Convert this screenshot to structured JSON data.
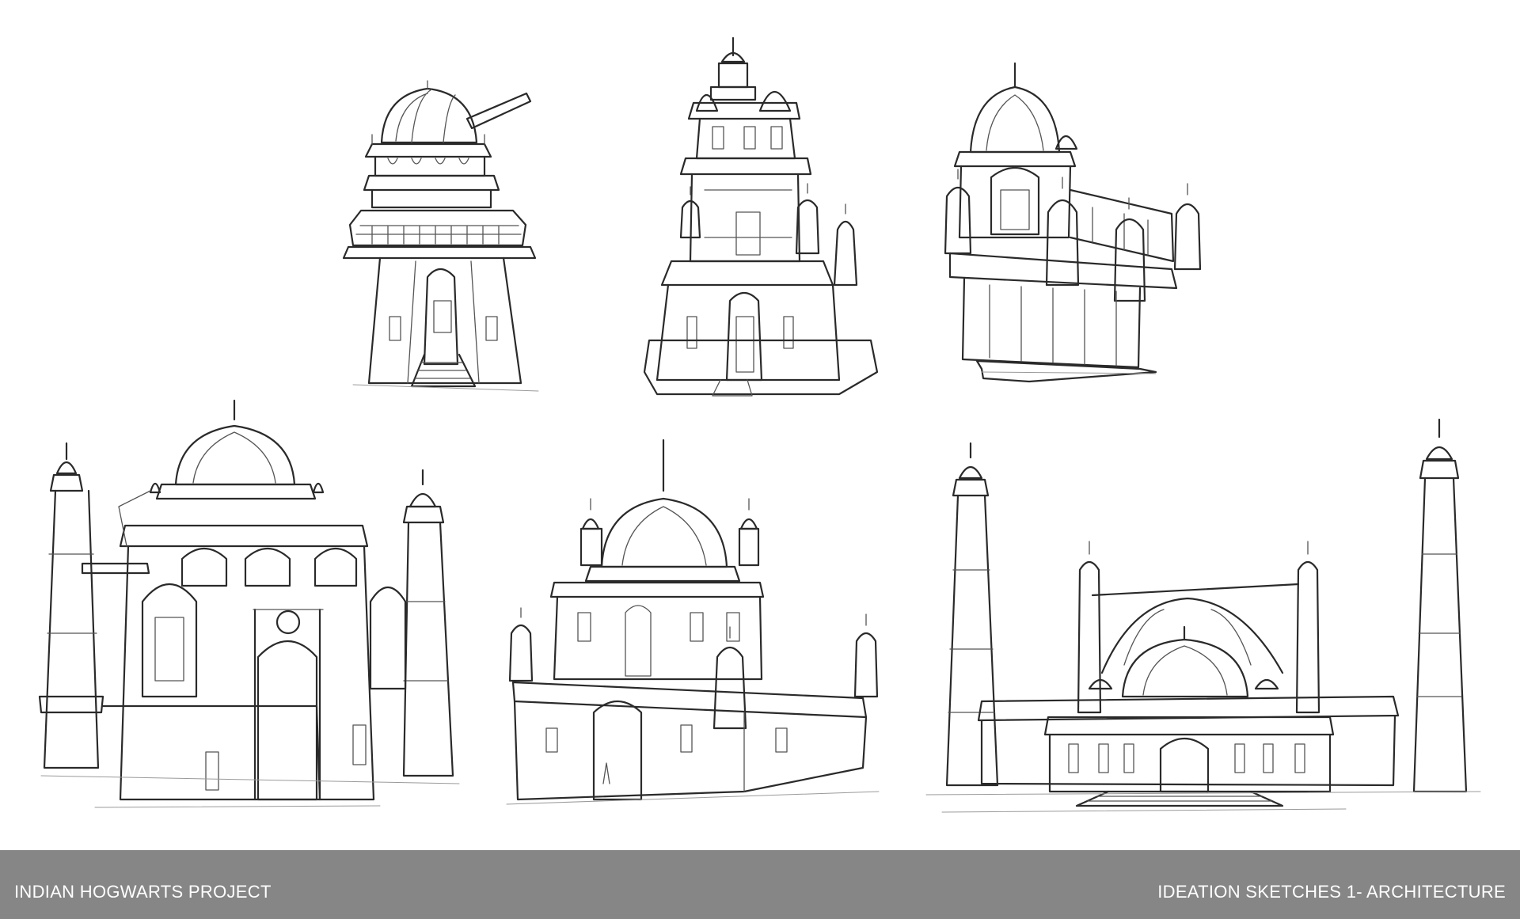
{
  "footer": {
    "project_title": "INDIAN HOGWARTS PROJECT",
    "sheet_title": "IDEATION SKETCHES 1- ARCHITECTURE"
  },
  "colors": {
    "background": "#ffffff",
    "footer_bar": "#868686",
    "footer_text": "#ffffff",
    "ink": "#2a2a2a"
  },
  "sketches": [
    {
      "name": "observatory-tower"
    },
    {
      "name": "tiered-temple-tower"
    },
    {
      "name": "floating-domed-palace"
    },
    {
      "name": "grand-gate-palace"
    },
    {
      "name": "domed-mosque-courtyard"
    },
    {
      "name": "great-mosque-with-minarets"
    }
  ]
}
